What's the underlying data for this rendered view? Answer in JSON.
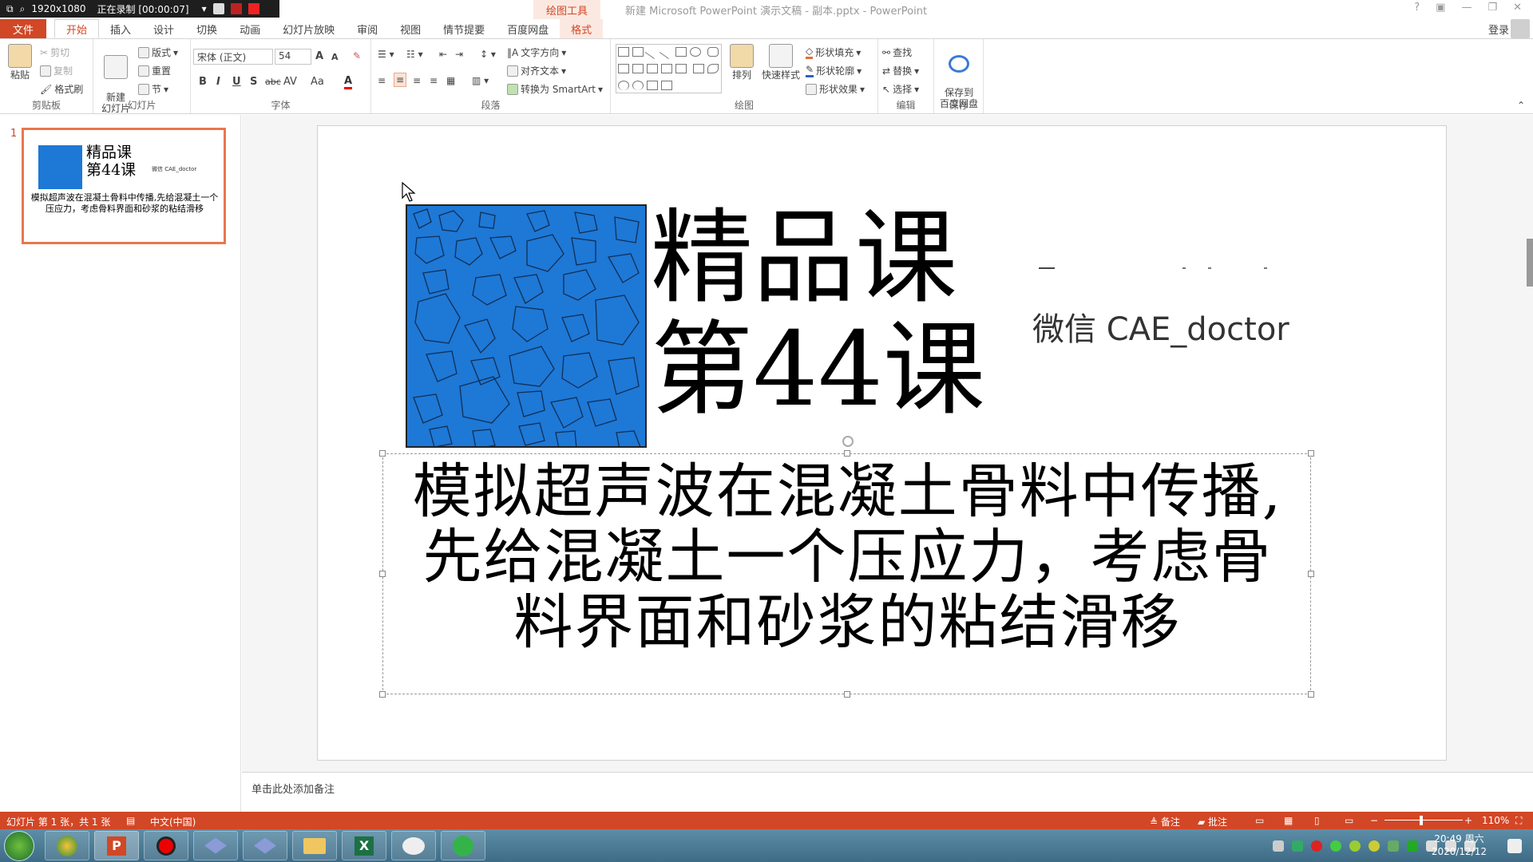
{
  "recorder": {
    "resolution": "1920x1080",
    "status": "正在录制 [00:00:07]"
  },
  "titlebar": {
    "tools_label": "绘图工具",
    "doc_title": "新建 Microsoft PowerPoint 演示文稿 - 副本.pptx - PowerPoint"
  },
  "tabs": [
    "文件",
    "开始",
    "插入",
    "设计",
    "切换",
    "动画",
    "幻灯片放映",
    "审阅",
    "视图",
    "情节提要",
    "百度网盘",
    "格式"
  ],
  "account": {
    "login": "登录"
  },
  "ribbon": {
    "clipboard": {
      "paste": "粘贴",
      "cut": "剪切",
      "copy": "复制",
      "format_painter": "格式刷",
      "label": "剪贴板"
    },
    "slides": {
      "new_slide": "新建\n幻灯片",
      "layout": "版式",
      "reset": "重置",
      "section": "节",
      "label": "幻灯片"
    },
    "font": {
      "name": "宋体 (正文)",
      "size": "54",
      "bold": "B",
      "italic": "I",
      "underline": "U",
      "shadow": "S",
      "strike": "abc",
      "spacing": "AV",
      "case": "Aa",
      "color": "A",
      "grow": "A",
      "shrink": "A",
      "label": "字体"
    },
    "paragraph": {
      "text_direction": "文字方向",
      "align_text": "对齐文本",
      "smartart": "转换为 SmartArt",
      "label": "段落"
    },
    "drawing": {
      "arrange": "排列",
      "quick_styles": "快速样式",
      "fill": "形状填充",
      "outline": "形状轮廓",
      "effects": "形状效果",
      "label": "绘图"
    },
    "editing": {
      "find": "查找",
      "replace": "替换",
      "select": "选择",
      "label": "编辑"
    },
    "save": {
      "save_baidu": "保存到\n百度网盘",
      "label": "保存"
    }
  },
  "thumbnails": [
    {
      "number": "1",
      "title": "精品课\n第44课",
      "wechat": "微信 CAE_doctor",
      "body": "模拟超声波在混凝土骨料中传播,先给混凝土一个压应力，考虑骨料界面和砂浆的粘结滑移"
    }
  ],
  "slide": {
    "title_line1": "精品课",
    "title_line2": "第44课",
    "wechat": "微信 CAE_doctor",
    "body_line1": "模拟超声波在混凝土骨料中传播,",
    "body_line2": "先给混凝土一个压应力，考虑骨",
    "body_line3": "料界面和砂浆的粘结滑移"
  },
  "notes": {
    "placeholder": "单击此处添加备注"
  },
  "statusbar": {
    "slide_count": "幻灯片 第 1 张，共 1 张",
    "language": "中文(中国)",
    "notes": "备注",
    "comments": "批注",
    "zoom": "110%"
  },
  "taskbar": {
    "time": "20:49 周六",
    "date": "2020/12/12"
  },
  "colors": {
    "accent": "#d24726",
    "concrete": "#1e78d6"
  }
}
